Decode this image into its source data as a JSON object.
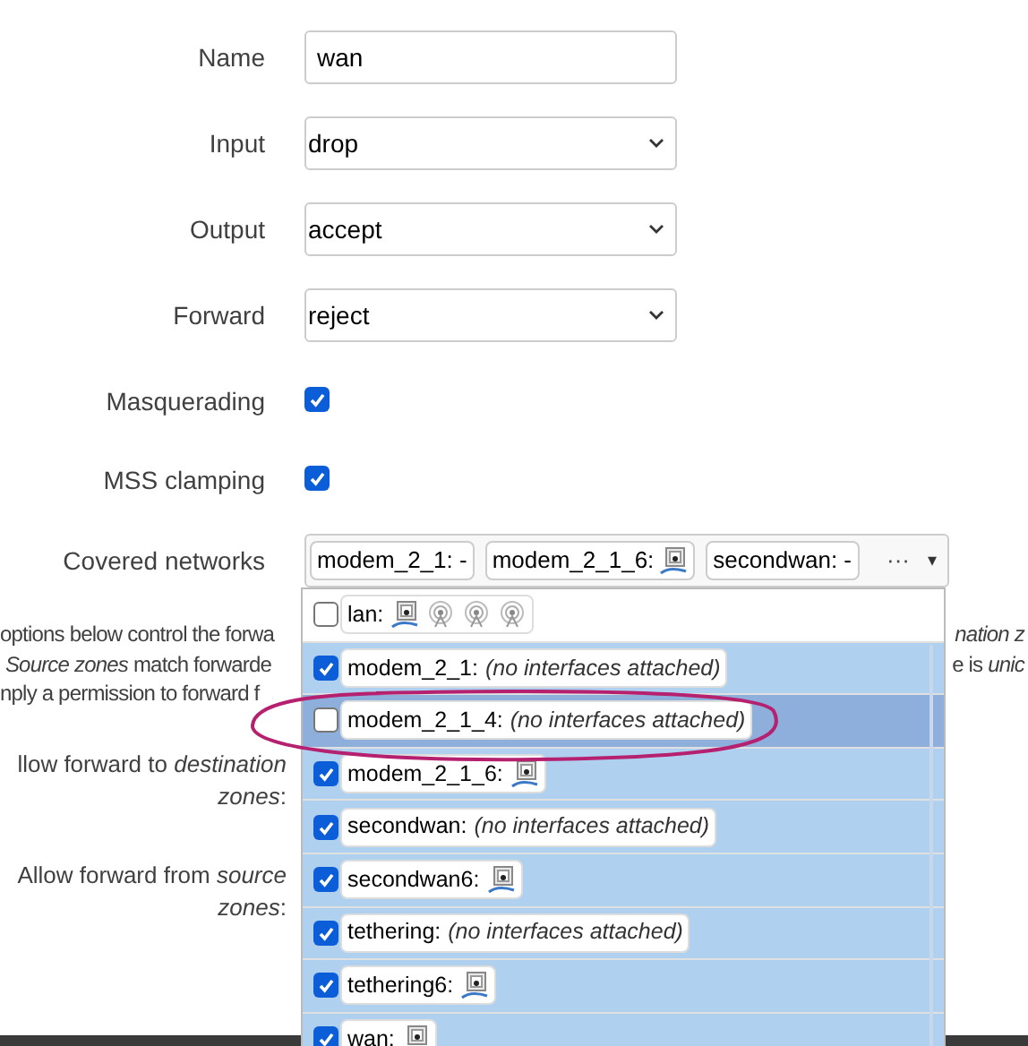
{
  "fields": [
    {
      "kind": "text",
      "label": "Name",
      "value": "wan"
    },
    {
      "kind": "select",
      "label": "Input",
      "value": "drop"
    },
    {
      "kind": "select",
      "label": "Output",
      "value": "accept"
    },
    {
      "kind": "select",
      "label": "Forward",
      "value": "reject"
    },
    {
      "kind": "checkbox",
      "label": "Masquerading",
      "checked": true
    },
    {
      "kind": "checkbox",
      "label": "MSS clamping",
      "checked": true
    }
  ],
  "covered_networks": {
    "label": "Covered networks",
    "chips": [
      {
        "text": "modem_2_1: -"
      },
      {
        "text": "modem_2_1_6:",
        "interfaces": [
          {
            "kind": "wired"
          }
        ]
      },
      {
        "text": "secondwan: -"
      }
    ],
    "more": "···",
    "caret": "▾",
    "options": [
      {
        "name": "lan:",
        "checked": false,
        "selected": false,
        "interfaces": [
          {
            "kind": "wired"
          },
          {
            "kind": "wireless"
          },
          {
            "kind": "wireless"
          },
          {
            "kind": "wireless"
          }
        ]
      },
      {
        "name": "modem_2_1:",
        "checked": true,
        "selected": false,
        "note": "(no interfaces attached)"
      },
      {
        "name": "modem_2_1_4:",
        "checked": false,
        "selected": true,
        "note": "(no interfaces attached)"
      },
      {
        "name": "modem_2_1_6:",
        "checked": true,
        "selected": false,
        "interfaces": [
          {
            "kind": "wired"
          }
        ]
      },
      {
        "name": "secondwan:",
        "checked": true,
        "selected": false,
        "note": "(no interfaces attached)"
      },
      {
        "name": "secondwan6:",
        "checked": true,
        "selected": false,
        "interfaces": [
          {
            "kind": "wired"
          }
        ]
      },
      {
        "name": "tethering:",
        "checked": true,
        "selected": false,
        "note": "(no interfaces attached)"
      },
      {
        "name": "tethering6:",
        "checked": true,
        "selected": false,
        "interfaces": [
          {
            "kind": "wired"
          }
        ]
      },
      {
        "name": "wan:",
        "checked": true,
        "selected": false,
        "interfaces": [
          {
            "kind": "wired"
          }
        ]
      }
    ]
  },
  "description_lines": [
    {
      "left": "options below control the forwa",
      "right": "*nation z*"
    },
    {
      "left": " *Source zones* match forwarde",
      "right": "e is *unic*"
    },
    {
      "left": "nply a permission to forward f"
    }
  ],
  "forward_labels": [
    {
      "lines": [
        "llow forward to *destination*",
        "*zones*:"
      ]
    },
    {
      "lines": [
        "Allow forward from *source*",
        "*zones*:"
      ]
    }
  ]
}
